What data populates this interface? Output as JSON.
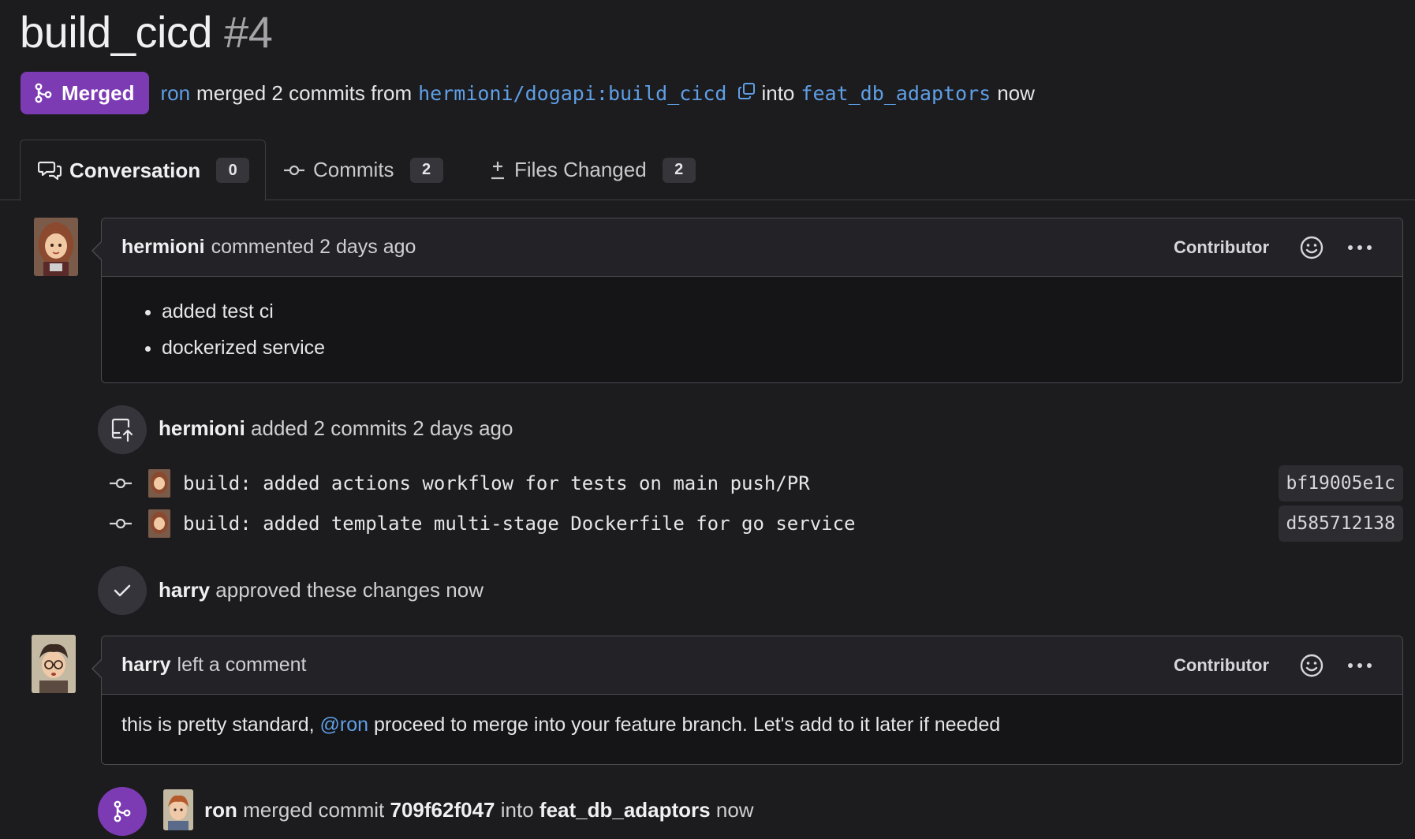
{
  "pr": {
    "title": "build_cicd",
    "number": "#4",
    "status": "Merged",
    "merger": "ron",
    "merged_text": "merged 2 commits from",
    "source_branch": "hermioni/dogapi:build_cicd",
    "into_text": "into",
    "target_branch": "feat_db_adaptors",
    "time": "now"
  },
  "tabs": [
    {
      "label": "Conversation",
      "count": "0"
    },
    {
      "label": "Commits",
      "count": "2"
    },
    {
      "label": "Files Changed",
      "count": "2"
    }
  ],
  "timeline": {
    "comment1": {
      "author": "hermioni",
      "action": "commented 2 days ago",
      "role": "Contributor",
      "items": [
        "added test ci",
        "dockerized service"
      ]
    },
    "commits_event": {
      "author": "hermioni",
      "text": "added 2 commits 2 days ago",
      "commits": [
        {
          "message": "build: added actions workflow for tests on main push/PR",
          "sha": "bf19005e1c"
        },
        {
          "message": "build: added template multi-stage Dockerfile for go service",
          "sha": "d585712138"
        }
      ]
    },
    "approval": {
      "author": "harry",
      "text": "approved these changes now"
    },
    "comment2": {
      "author": "harry",
      "action": "left a comment",
      "role": "Contributor",
      "body_before": "this is pretty standard,",
      "mention": "@ron",
      "body_after": "proceed to merge into your feature branch. Let's add to it later if needed"
    },
    "merge_event": {
      "author": "ron",
      "text1": "merged commit",
      "sha": "709f62f047",
      "text2": "into",
      "branch": "feat_db_adaptors",
      "time": "now"
    }
  },
  "colors": {
    "background": "#1c1c1f",
    "merged": "#7c3bb3",
    "link": "#5f9fe6"
  }
}
